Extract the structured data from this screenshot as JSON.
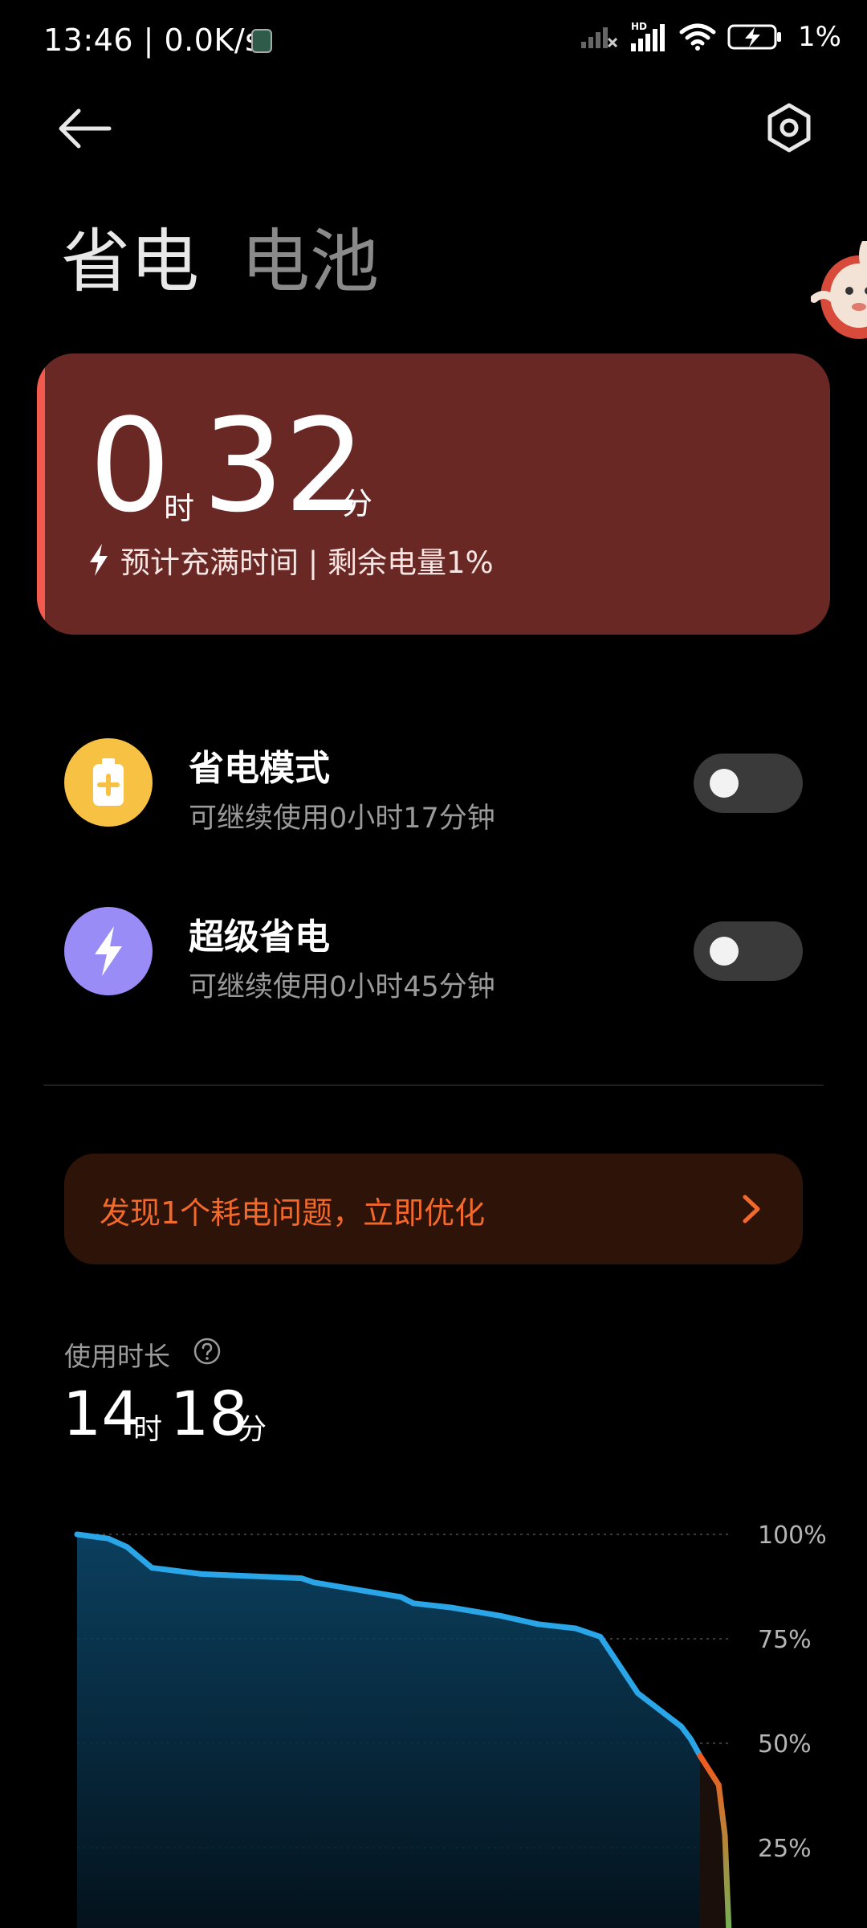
{
  "status_bar": {
    "time": "13:46 | 0.0K/s",
    "battery_percent": "1%",
    "icons": [
      "shield-app-icon",
      "signal-no-service-icon",
      "hd-signal-icon",
      "wifi-icon",
      "battery-charging-icon"
    ]
  },
  "top_bar": {
    "back_icon": "arrow-left-icon",
    "settings_icon": "hexagon-settings-icon"
  },
  "tabs": [
    {
      "label": "省电",
      "active": true
    },
    {
      "label": "电池",
      "active": false
    }
  ],
  "charge_card": {
    "hours": "0",
    "hours_unit": "时",
    "minutes": "32",
    "minutes_unit": "分",
    "info_icon": "lightning-icon",
    "info_text": "预计充满时间 | 剩余电量1%",
    "accent_color": "#f25a4e",
    "background_color": "#6a2825"
  },
  "modes": [
    {
      "title": "省电模式",
      "subtitle": "可继续使用0小时17分钟",
      "icon": "battery-plus-icon",
      "icon_color": "#f7c144",
      "enabled": false
    },
    {
      "title": "超级省电",
      "subtitle": "可继续使用0小时45分钟",
      "icon": "lightning-icon",
      "icon_color": "#9a8cf7",
      "enabled": false
    }
  ],
  "issue_banner": {
    "text": "发现1个耗电问题，立即优化",
    "icon": "chevron-right-icon",
    "text_color": "#f2692c"
  },
  "usage": {
    "label": "使用时长",
    "help_icon": "question-circle-icon",
    "hours": "14",
    "hours_unit": "时",
    "minutes": "18",
    "minutes_unit": "分"
  },
  "chart_data": {
    "type": "area",
    "ylim": [
      0,
      100
    ],
    "y_ticks": [
      "100%",
      "75%",
      "50%",
      "25%"
    ],
    "y_tick_values": [
      100,
      75,
      50,
      25
    ],
    "grid": true,
    "x": [
      0,
      5,
      8,
      12,
      20,
      36,
      38,
      48,
      52,
      54,
      60,
      68,
      74,
      80,
      84,
      86,
      90,
      97,
      98.5,
      100
    ],
    "series": [
      {
        "color": "#2aa6e8",
        "values": [
          100,
          99,
          97,
          92,
          90.5,
          89.5,
          88.5,
          86,
          85,
          83.5,
          82.5,
          80.5,
          78.5,
          77.5,
          75.5,
          71,
          62,
          54,
          51,
          47
        ]
      },
      {
        "color": "#f25a1e",
        "values": null
      },
      {
        "color": "#46d16a",
        "values": null
      }
    ],
    "charging_segment": {
      "x": [
        100,
        103,
        104,
        104.5,
        105
      ],
      "values": [
        47,
        40,
        28,
        10,
        -10
      ]
    }
  }
}
